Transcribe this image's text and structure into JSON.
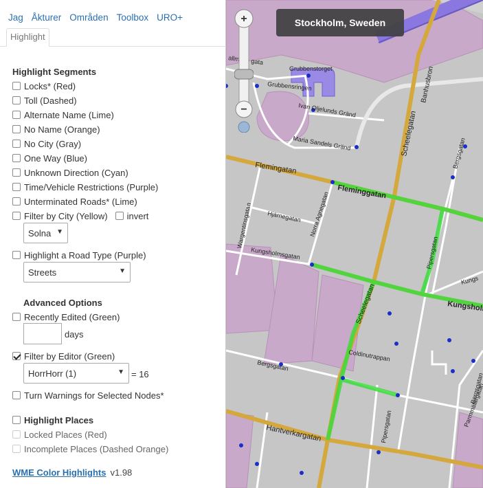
{
  "nav": {
    "tabs": [
      "Jag",
      "Åkturer",
      "Områden",
      "Toolbox",
      "URO+"
    ],
    "active_tab": "Highlight"
  },
  "highlight": {
    "title": "Highlight Segments",
    "items": [
      {
        "label": "Locks* (Red)",
        "checked": false
      },
      {
        "label": "Toll (Dashed)",
        "checked": false
      },
      {
        "label": "Alternate Name (Lime)",
        "checked": false
      },
      {
        "label": "No Name (Orange)",
        "checked": false
      },
      {
        "label": "No City (Gray)",
        "checked": false
      },
      {
        "label": "One Way (Blue)",
        "checked": false
      },
      {
        "label": "Unknown Direction (Cyan)",
        "checked": false
      },
      {
        "label": "Time/Vehicle Restrictions (Purple)",
        "checked": false
      },
      {
        "label": "Unterminated Roads* (Lime)",
        "checked": false
      }
    ],
    "city_filter": {
      "label": "Filter by City (Yellow)",
      "invert_label": "invert",
      "city_value": "Solna"
    },
    "road_type": {
      "label": "Highlight a Road Type (Purple)",
      "value": "Streets"
    }
  },
  "advanced": {
    "title": "Advanced Options",
    "recently_edited": {
      "label": "Recently Edited (Green)",
      "days_label": "days"
    },
    "editor_filter": {
      "label": "Filter by Editor (Green)",
      "checked": true,
      "editor_value": "HorrHorr (1)",
      "count_text": "= 16"
    },
    "turn_warnings": {
      "label": "Turn Warnings for Selected Nodes*"
    }
  },
  "places": {
    "title": "Highlight Places",
    "locked_label": "Locked Places (Red)",
    "incomplete_label": "Incomplete Places (Dashed Orange)"
  },
  "footer": {
    "link": "WME Color Highlights",
    "version": "v1.98"
  },
  "map": {
    "location": "Stockholm, Sweden",
    "streets": {
      "flemingatan_w": "Flemingatan",
      "flemingatan_e": "Fleminggatan",
      "scheelegatan_n": "Scheelegatan",
      "scheelegatan_s": "Scheelegatan",
      "banhusbron": "Banhusbron",
      "grubbenstorget": "Grubbenstorget",
      "grubbensringen": "Grubbensringen",
      "ivan": "Ivan Oljelunds Gränd",
      "maria": "Maria Sandels Gränd",
      "norra_agnegatan": "Norra Agnegatan",
      "hjarnegatan": "Hjärnegatan",
      "wargentinsgatan": "Wargentinsgatan",
      "kungsholmsgatan": "Kungsholmsgatan",
      "kungsholmsgatan_e": "Kungsholm",
      "pipersgatan_n": "Pipersgatan",
      "pipersgatan_s": "Pipersgatan",
      "coldinutrappan": "Coldinutrappan",
      "bergsgatan": "Bergsgatan",
      "hantverkargatan": "Hantverkargatan",
      "parmmatargatan": "Parmmätargatan",
      "bergsgatan_e": "Bergsgatan",
      "kungs": "Kungs",
      "allmans": "allmans gata"
    },
    "colors": {
      "highlight_green": "#3ddc3d",
      "primary_road": "#d4a83c",
      "park_purple": "#c8a8c8",
      "place_purple": "#9a8ae6"
    }
  }
}
